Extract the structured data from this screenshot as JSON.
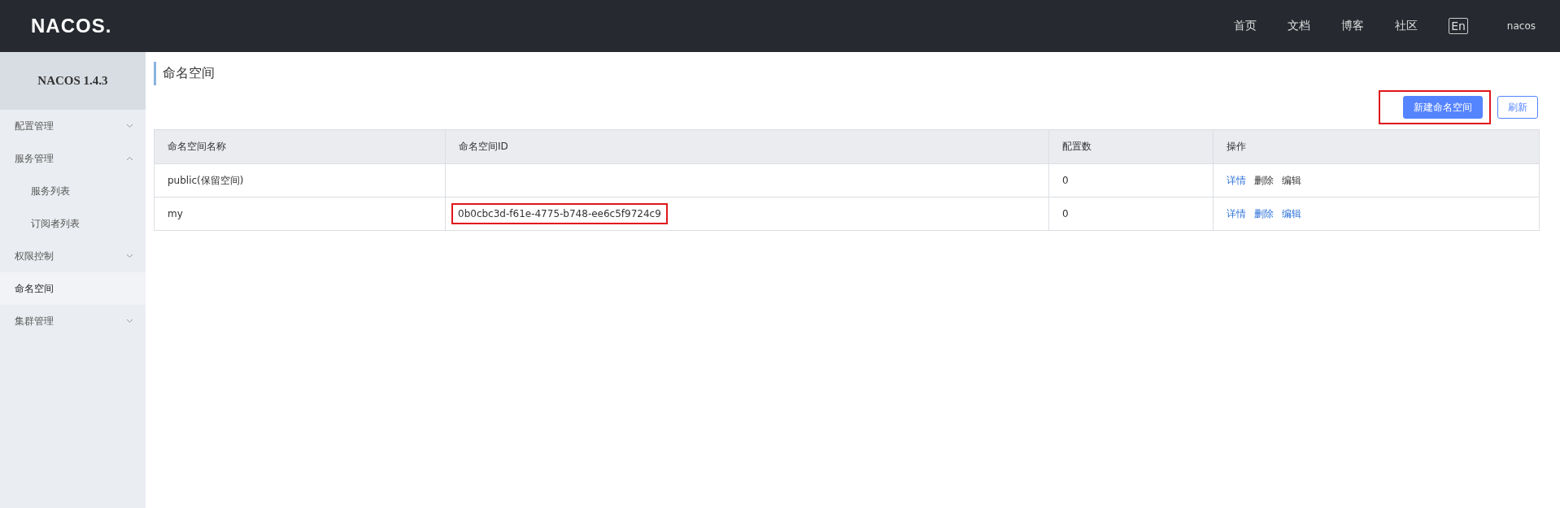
{
  "header": {
    "logo": "NACOS.",
    "nav": [
      {
        "label": "首页"
      },
      {
        "label": "文档"
      },
      {
        "label": "博客"
      },
      {
        "label": "社区"
      }
    ],
    "language": "En",
    "user": "nacos"
  },
  "sidebar": {
    "version": "NACOS 1.4.3",
    "items": [
      {
        "label": "配置管理",
        "kind": "group",
        "selected": false,
        "expanded": false
      },
      {
        "label": "服务管理",
        "kind": "group",
        "selected": false,
        "expanded": true,
        "children": [
          {
            "label": "服务列表",
            "selected": false
          },
          {
            "label": "订阅者列表",
            "selected": false
          }
        ]
      },
      {
        "label": "权限控制",
        "kind": "group",
        "selected": false,
        "expanded": false
      },
      {
        "label": "命名空间",
        "kind": "link",
        "selected": true
      },
      {
        "label": "集群管理",
        "kind": "group",
        "selected": false,
        "expanded": false
      }
    ]
  },
  "page": {
    "title": "命名空间",
    "buttons": [
      {
        "label": "新建命名空间",
        "kind": "primary",
        "annotated": true
      },
      {
        "label": "刷新",
        "kind": "outline",
        "annotated": false
      }
    ]
  },
  "table": {
    "columns": [
      "命名空间名称",
      "命名空间ID",
      "配置数",
      "操作"
    ],
    "rows": [
      {
        "name": "public(保留空间)",
        "id": "",
        "id_annotated": false,
        "count": "0",
        "actions": [
          {
            "label": "详情",
            "disabled": false
          },
          {
            "label": "删除",
            "disabled": true
          },
          {
            "label": "编辑",
            "disabled": true
          }
        ]
      },
      {
        "name": "my",
        "id": "0b0cbc3d-f61e-4775-b748-ee6c5f9724c9",
        "id_annotated": true,
        "count": "0",
        "actions": [
          {
            "label": "详情",
            "disabled": false
          },
          {
            "label": "删除",
            "disabled": false
          },
          {
            "label": "编辑",
            "disabled": false
          }
        ]
      }
    ]
  }
}
